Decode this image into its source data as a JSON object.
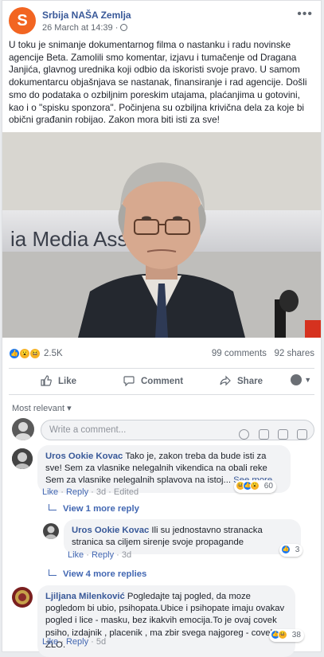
{
  "post": {
    "page_name": "Srbija NAŠA Zemlja",
    "logo_letter": "S",
    "time": "26 March at 14:39 ·",
    "more": "•••",
    "text": "U toku je snimanje dokumentarnog filma o nastanku i radu novinske agencije Beta. Zamolili smo komentar, izjavu i tumačenje od Dragana Janjića, glavnog urednika koji odbio da iskoristi svoje pravo. U samom dokumentarcu objašnjava se nastanak, finansiranje i rad agencije. Došli smo do podataka o ozbiljnim poreskim utajama, plaćanjima u gotovini, kao i o \"spisku sponzora\". Počinjena su ozbiljna krivična dela za koje bi obični građanin robijao. Zakon mora biti isti za sve!",
    "photo_banner_text": "ia Media Assis      gram"
  },
  "stats": {
    "reactions": "2.5K",
    "comments": "99 comments",
    "shares": "92 shares"
  },
  "actions": {
    "like": "Like",
    "comment": "Comment",
    "share": "Share"
  },
  "comments_section": {
    "sort": "Most relevant ▾",
    "placeholder": "Write a comment..."
  },
  "comments": [
    {
      "author": "Uros Ookie Kovac",
      "text": "Tako je, zakon treba da bude isti za sve! Sem za vlasnike nelegalnih vikendica na obali reke Sem za vlasnike nelegalnih splavova na istoj...",
      "see_more": "See more",
      "like": "Like",
      "reply": "Reply",
      "age": "3d",
      "edited": "Edited",
      "reactions": "60",
      "view_replies": "View 1 more reply"
    },
    {
      "author": "Uros Ookie Kovac",
      "text": "Ili su jednostavno stranacka stranica sa ciljem sirenje svoje propagande",
      "like": "Like",
      "reply": "Reply",
      "age": "3d",
      "reactions": "3",
      "view_replies": "View 4 more replies"
    },
    {
      "author": "Ljiljana Milenković",
      "text": "Pogledajte taj pogled, da moze pogledom bi ubio, psihopata.Ubice i psihopate imaju ovakav pogled i lice - masku, bez ikakvih emocija.To je ovaj covek psiho, izdajnik , placenik , ma zbir svega najgoreg - covek ZLO.",
      "like": "Like",
      "reply": "Reply",
      "age": "5d",
      "reactions": "38"
    }
  ],
  "colors": {
    "link": "#385898",
    "brand_logo": "#f26522",
    "like_blue": "#1877f2"
  }
}
